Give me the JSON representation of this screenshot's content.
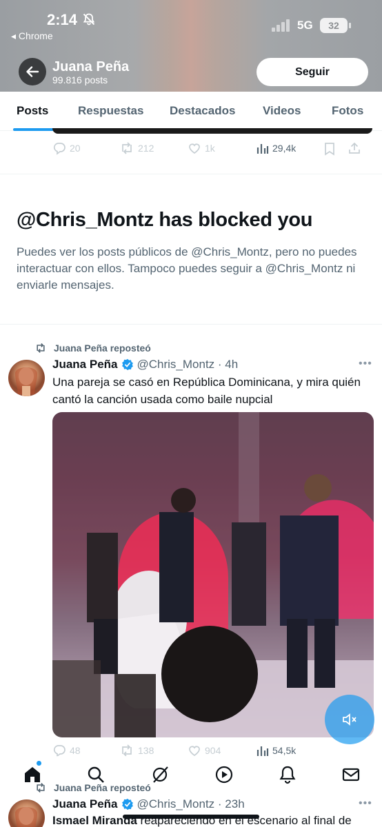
{
  "status_bar": {
    "time": "2:14",
    "back_app": "◂ Chrome",
    "network": "5G",
    "battery": "32"
  },
  "profile_header": {
    "name": "Juana Peña",
    "posts_count": "99.816 posts",
    "follow_label": "Seguir"
  },
  "tabs": [
    {
      "label": "Posts",
      "active": true
    },
    {
      "label": "Respuestas",
      "active": false
    },
    {
      "label": "Destacados",
      "active": false
    },
    {
      "label": "Videos",
      "active": false
    },
    {
      "label": "Fotos",
      "active": false
    }
  ],
  "prev_tweet": {
    "replies": "20",
    "reposts": "212",
    "likes": "1k",
    "views": "29,4k"
  },
  "blocked": {
    "title": "@Chris_Montz has blocked you",
    "body": "Puedes ver los posts públicos de @Chris_Montz, pero no puedes interactuar con ellos. Tampoco puedes seguir a @Chris_Montz ni enviarle mensajes."
  },
  "tweet1": {
    "repost_label": "Juana Peña reposteó",
    "author_name": "Juana Peña",
    "handle_time": "@Chris_Montz · 4h",
    "text": "Una pareja se casó en República Dominicana, y mira quién cantó la canción usada como baile nupcial",
    "replies": "48",
    "reposts": "138",
    "likes": "904",
    "views": "54,5k"
  },
  "tweet2": {
    "repost_label": "Juana Peña reposteó",
    "author_name": "Juana Peña",
    "handle_time": "@Chris_Montz · 23h",
    "text_bold": "Ismael Miranda",
    "text_rest": " reapareciendo en el escenario al final de"
  },
  "colors": {
    "accent": "#1d9bf0",
    "text_primary": "#0f1419",
    "text_secondary": "#536471"
  },
  "icons": [
    "bell-off-icon",
    "back-arrow-icon",
    "reply-icon",
    "repost-icon",
    "like-icon",
    "views-icon",
    "bookmark-icon",
    "share-icon",
    "verified-icon",
    "more-icon",
    "mute-icon",
    "home-icon",
    "search-icon",
    "grok-icon",
    "video-icon",
    "notifications-icon",
    "messages-icon"
  ]
}
